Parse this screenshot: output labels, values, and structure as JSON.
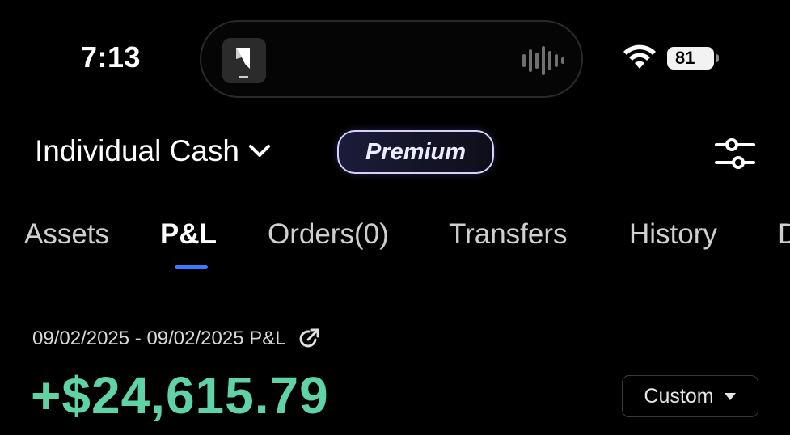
{
  "status_bar": {
    "time": "7:13",
    "battery_level": "81",
    "icons": [
      "app-icon",
      "waveform-icon",
      "wifi-icon",
      "battery-icon"
    ]
  },
  "header": {
    "account_name": "Individual Cash",
    "badge": "Premium",
    "icons": [
      "chevron-down-icon",
      "filter-sliders-icon"
    ]
  },
  "tabs": [
    {
      "label": "Assets",
      "active": false
    },
    {
      "label": "P&L",
      "active": true
    },
    {
      "label": "Orders(0)",
      "active": false
    },
    {
      "label": "Transfers",
      "active": false
    },
    {
      "label": "History",
      "active": false
    },
    {
      "label": "D",
      "active": false
    }
  ],
  "pnl": {
    "range_label": "09/02/2025 - 09/02/2025 P&L",
    "amount": "+$24,615.79",
    "period_select": "Custom"
  },
  "colors": {
    "background": "#000000",
    "gain": "#5fd3a5",
    "tab_indicator": "#3a7bff",
    "premium_border": "#d6d0ff"
  }
}
